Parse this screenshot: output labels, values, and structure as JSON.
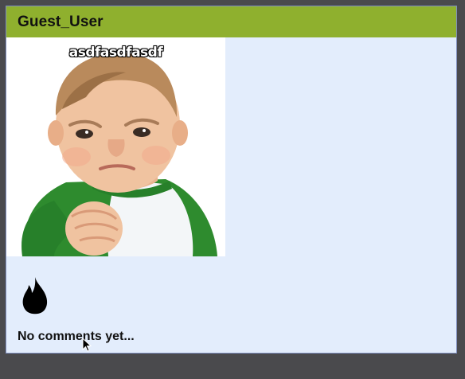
{
  "post": {
    "username": "Guest_User",
    "meme_caption": "asdfasdfasdf",
    "reaction_icon": "flame-icon",
    "comments_empty_text": "No comments yet..."
  },
  "colors": {
    "header_bg": "#8fb02e",
    "card_bg": "#e3edfc",
    "page_bg": "#4a4a4d"
  }
}
